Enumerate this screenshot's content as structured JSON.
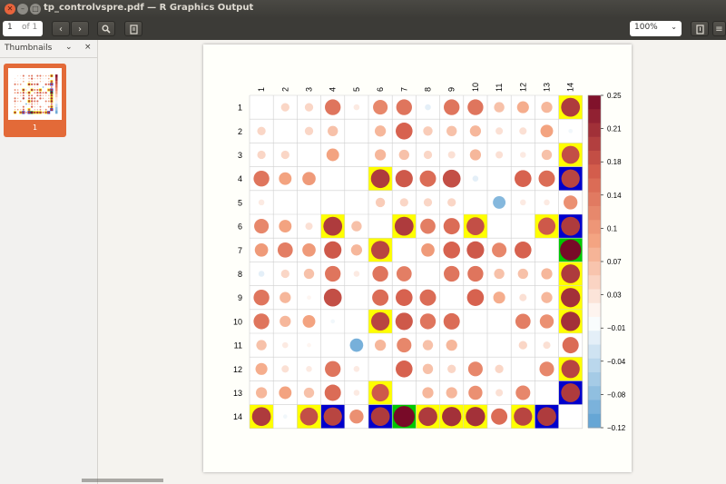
{
  "window": {
    "title": "tp_controlvspre.pdf — R Graphics Output"
  },
  "toolbar": {
    "page_current": "1",
    "page_of": "of 1",
    "zoom": "100%"
  },
  "sidebar": {
    "label": "Thumbnails",
    "thumbnail_label": "1"
  },
  "colors": {
    "accent": "#e36a38",
    "highlight_yellow": "#ffff00",
    "highlight_blue": "#0000cc",
    "highlight_green": "#00c800"
  },
  "chart_data": {
    "type": "heatmap",
    "subtype": "correlation-plot",
    "labels": [
      "1",
      "2",
      "3",
      "4",
      "5",
      "6",
      "7",
      "8",
      "9",
      "10",
      "11",
      "12",
      "13",
      "14"
    ],
    "matrix": [
      [
        0,
        0.04,
        0.04,
        0.14,
        0.02,
        0.12,
        0.14,
        -0.02,
        0.14,
        0.14,
        0.06,
        0.08,
        0.07,
        0.2
      ],
      [
        0.04,
        0,
        0.04,
        0.06,
        0,
        0.07,
        0.16,
        0.05,
        0.06,
        0.07,
        0.03,
        0.03,
        0.09,
        -0.01
      ],
      [
        0.04,
        0.04,
        0,
        0.09,
        0,
        0.07,
        0.06,
        0.04,
        0.03,
        0.07,
        0.03,
        0.02,
        0.06,
        0.18
      ],
      [
        0.14,
        0.09,
        0.1,
        0,
        0,
        0.2,
        0.17,
        0.15,
        0.18,
        -0.02,
        0,
        0.16,
        0.15,
        0.19
      ],
      [
        0.02,
        0,
        0,
        0,
        0,
        0.05,
        0.04,
        0.04,
        0.04,
        0,
        -0.09,
        0.02,
        0.02,
        0.11
      ],
      [
        0.12,
        0.09,
        0.03,
        0.2,
        0.06,
        0,
        0.2,
        0.13,
        0.15,
        0.18,
        0,
        0,
        0.17,
        0.2
      ],
      [
        0.1,
        0.13,
        0.1,
        0.17,
        0.07,
        0.19,
        0,
        0.1,
        0.16,
        0.17,
        0.12,
        0.16,
        0,
        0.25
      ],
      [
        -0.02,
        0.04,
        0.06,
        0.14,
        0.02,
        0.14,
        0.13,
        0,
        0.14,
        0.14,
        0.06,
        0.06,
        0.07,
        0.2
      ],
      [
        0.14,
        0.07,
        0.01,
        0.18,
        0,
        0.15,
        0.16,
        0.15,
        0,
        0.16,
        0.08,
        0.03,
        0.07,
        0.21
      ],
      [
        0.14,
        0.07,
        0.09,
        -0.01,
        0,
        0.19,
        0.17,
        0.14,
        0.15,
        0,
        0,
        0.13,
        0.11,
        0.21
      ],
      [
        0.06,
        0.02,
        0.01,
        0,
        -0.1,
        0.07,
        0.12,
        0.06,
        0.07,
        0,
        0,
        0.04,
        0.03,
        0.15
      ],
      [
        0.08,
        0.03,
        0.02,
        0.14,
        0.02,
        0,
        0.16,
        0.06,
        0.04,
        0.12,
        0.04,
        0,
        0.12,
        0.19
      ],
      [
        0.07,
        0.09,
        0.06,
        0.15,
        0.02,
        0.17,
        0,
        0.07,
        0.07,
        0.11,
        0.03,
        0.12,
        0,
        0.2
      ],
      [
        0.2,
        -0.01,
        0.18,
        0.19,
        0.11,
        0.2,
        0.25,
        0.2,
        0.21,
        0.21,
        0.15,
        0.19,
        0.2,
        0
      ]
    ],
    "highlight_yellow": [
      [
        1,
        14
      ],
      [
        3,
        14
      ],
      [
        4,
        6
      ],
      [
        6,
        4
      ],
      [
        6,
        7
      ],
      [
        6,
        10
      ],
      [
        6,
        13
      ],
      [
        7,
        6
      ],
      [
        8,
        14
      ],
      [
        9,
        14
      ],
      [
        10,
        6
      ],
      [
        10,
        14
      ],
      [
        12,
        14
      ],
      [
        13,
        6
      ],
      [
        14,
        1
      ],
      [
        14,
        3
      ],
      [
        14,
        7
      ],
      [
        14,
        8
      ],
      [
        14,
        9
      ],
      [
        14,
        10
      ],
      [
        14,
        12
      ],
      [
        14,
        13
      ]
    ],
    "highlight_blue": [
      [
        4,
        14
      ],
      [
        6,
        14
      ],
      [
        13,
        14
      ],
      [
        14,
        4
      ],
      [
        14,
        6
      ],
      [
        14,
        13
      ]
    ],
    "highlight_green": [
      [
        7,
        14
      ],
      [
        14,
        7
      ]
    ],
    "legend_ticks": [
      "0.25",
      "0.21",
      "0.18",
      "0.14",
      "0.1",
      "0.07",
      "0.03",
      "−0.01",
      "−0.04",
      "−0.08",
      "−0.12"
    ],
    "ylim": [
      -0.12,
      0.25
    ],
    "legend_position": "right"
  }
}
